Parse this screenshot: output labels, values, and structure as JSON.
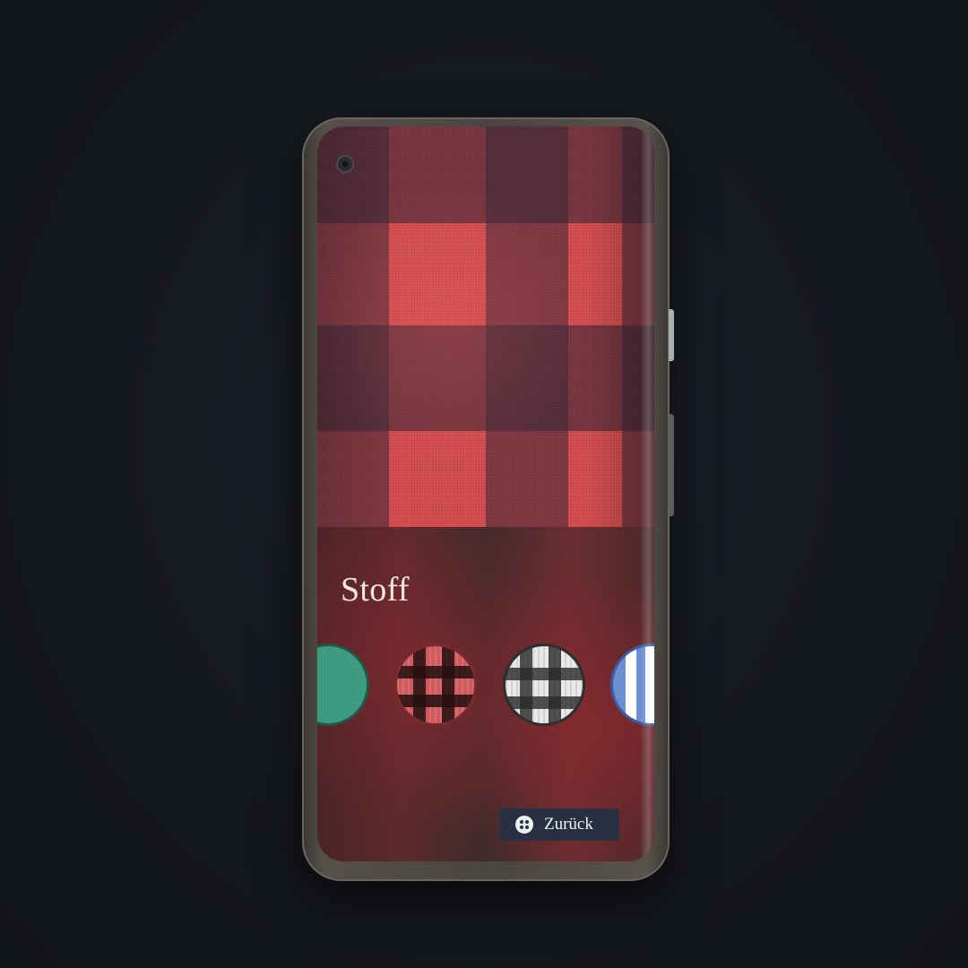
{
  "panel": {
    "title": "Stoff"
  },
  "swatches": [
    {
      "name": "green",
      "color": "#3f9a82"
    },
    {
      "name": "red-plaid",
      "color": "#d05a5c"
    },
    {
      "name": "gray-plaid",
      "color": "#e9e9e9"
    },
    {
      "name": "blue-stripe",
      "color": "#6d8ed0"
    }
  ],
  "selected_fabric": "red-plaid",
  "back_button": {
    "label": "Zurück",
    "icon": "button-icon"
  },
  "colors": {
    "fabric_red": "#d64f52",
    "button_bg": "#283042",
    "title_text": "#f1e6df"
  }
}
